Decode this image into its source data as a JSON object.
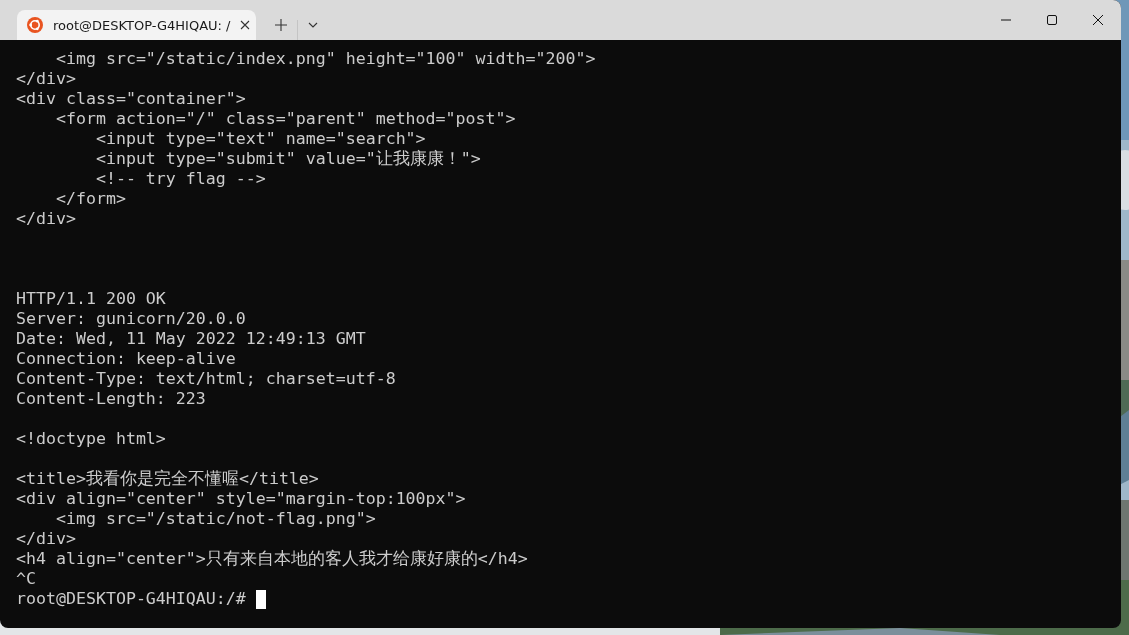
{
  "tabs": [
    {
      "title": "root@DESKTOP-G4HIQAU: /",
      "selected": true
    }
  ],
  "terminal": {
    "lines": [
      {
        "kind": "text",
        "text": "    <img src=\"/static/index.png\" height=\"100\" width=\"200\">"
      },
      {
        "kind": "text",
        "text": "</div>"
      },
      {
        "kind": "text",
        "text": "<div class=\"container\">"
      },
      {
        "kind": "text",
        "text": "    <form action=\"/\" class=\"parent\" method=\"post\">"
      },
      {
        "kind": "text",
        "text": "        <input type=\"text\" name=\"search\">"
      },
      {
        "kind": "text",
        "text": "        <input type=\"submit\" value=\"让我康康！\">"
      },
      {
        "kind": "text",
        "text": "        <!-- try flag -->"
      },
      {
        "kind": "text",
        "text": "    </form>"
      },
      {
        "kind": "text",
        "text": "</div>"
      },
      {
        "kind": "blank"
      },
      {
        "kind": "blank"
      },
      {
        "kind": "blank"
      },
      {
        "kind": "text",
        "text": "HTTP/1.1 200 OK"
      },
      {
        "kind": "text",
        "text": "Server: gunicorn/20.0.0"
      },
      {
        "kind": "text",
        "text": "Date: Wed, 11 May 2022 12:49:13 GMT"
      },
      {
        "kind": "text",
        "text": "Connection: keep-alive"
      },
      {
        "kind": "text",
        "text": "Content-Type: text/html; charset=utf-8"
      },
      {
        "kind": "text",
        "text": "Content-Length: 223"
      },
      {
        "kind": "blank"
      },
      {
        "kind": "text",
        "text": "<!doctype html>"
      },
      {
        "kind": "blank"
      },
      {
        "kind": "text",
        "text": "<title>我看你是完全不懂喔</title>"
      },
      {
        "kind": "text",
        "text": "<div align=\"center\" style=\"margin-top:100px\">"
      },
      {
        "kind": "text",
        "text": "    <img src=\"/static/not-flag.png\">"
      },
      {
        "kind": "text",
        "text": "</div>"
      },
      {
        "kind": "text",
        "text": "<h4 align=\"center\">只有来自本地的客人我才给康好康的</h4>"
      },
      {
        "kind": "text",
        "text": "^C"
      },
      {
        "kind": "prompt",
        "text": "root@DESKTOP-G4HIQAU:/#"
      }
    ]
  }
}
